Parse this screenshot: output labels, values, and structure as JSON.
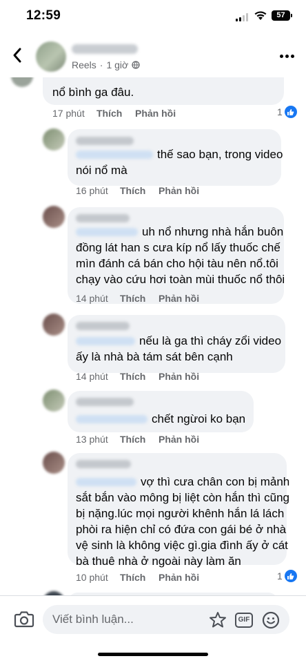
{
  "status_bar": {
    "time": "12:59",
    "battery": "57"
  },
  "post": {
    "source": "Reels",
    "age": "1 giờ",
    "separator": "·"
  },
  "comments": [
    {
      "text": "nổ bình ga đâu.",
      "time": "17 phút",
      "like": "Thích",
      "reply": "Phản hồi",
      "reactions": "1"
    },
    {
      "text_1": "thế sao bạn, trong video",
      "text_2": "nói nổ mà",
      "time": "16 phút",
      "like": "Thích",
      "reply": "Phản hồi"
    },
    {
      "text_1": "uh nổ nhưng nhà hắn buôn",
      "text_2": "đồng lát han s cưa kíp nổ lấy thuốc chế",
      "text_3": "mìn đánh cá bán cho hội tàu nên nổ.tôi",
      "text_4": "chạy vào cứu hơi toàn mùi thuốc nổ thôi",
      "time": "14 phút",
      "like": "Thích",
      "reply": "Phản hồi"
    },
    {
      "text_1": "nếu là ga thì cháy zổi video",
      "text_2": "ấy là nhà bà tám sát bên cạnh",
      "time": "14 phút",
      "like": "Thích",
      "reply": "Phản hồi"
    },
    {
      "text_1": "chết ngừoi ko bạn",
      "time": "13 phút",
      "like": "Thích",
      "reply": "Phản hồi"
    },
    {
      "text_1": "vợ thì cưa chân con bị mảnh",
      "text_2": "sắt bắn vào mông bị liệt còn hắn thì cũng",
      "text_3": "bị nặng.lúc mọi người khênh hắn lá lách",
      "text_4": "phòi ra hiện chỉ có đứa con gái bé ở nhà",
      "text_5": "vệ sinh là không việc gì.gia đình ấy ở cát",
      "text_6": "bà thuê nhà ở ngoài này làm ăn",
      "time": "10 phút",
      "like": "Thích",
      "reply": "Phản hồi",
      "reactions": "1"
    }
  ],
  "composer": {
    "placeholder": "Viết bình luận...",
    "gif_label": "GIF"
  }
}
